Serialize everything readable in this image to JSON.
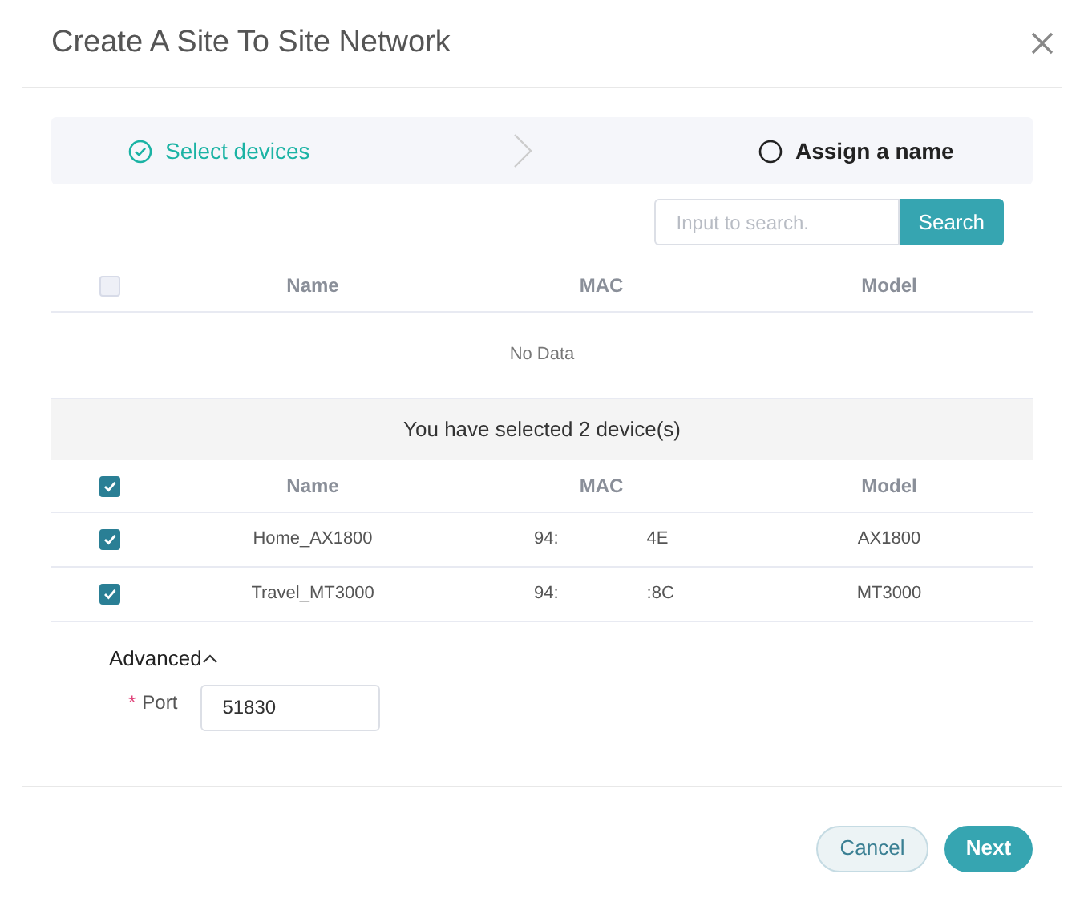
{
  "dialog": {
    "title": "Create A Site To Site Network"
  },
  "steps": [
    {
      "label": "Select devices",
      "done": true
    },
    {
      "label": "Assign a name",
      "done": false
    }
  ],
  "search": {
    "placeholder": "Input to search.",
    "button": "Search"
  },
  "available_table": {
    "all_checked": false,
    "columns": [
      "Name",
      "MAC",
      "Model"
    ],
    "empty_text": "No Data"
  },
  "selected_summary": "You have selected 2 device(s)",
  "selected_table": {
    "all_checked": true,
    "columns": [
      "Name",
      "MAC",
      "Model"
    ],
    "rows": [
      {
        "checked": true,
        "name": "Home_AX1800",
        "mac_start": "94:",
        "mac_end": "4E",
        "model": "AX1800"
      },
      {
        "checked": true,
        "name": "Travel_MT3000",
        "mac_start": "94:",
        "mac_end": ":8C",
        "model": "MT3000"
      }
    ]
  },
  "advanced": {
    "label": "Advanced",
    "expanded": true,
    "port_label": "Port",
    "required_mark": "*",
    "port_value": "51830"
  },
  "buttons": {
    "cancel": "Cancel",
    "next": "Next"
  }
}
